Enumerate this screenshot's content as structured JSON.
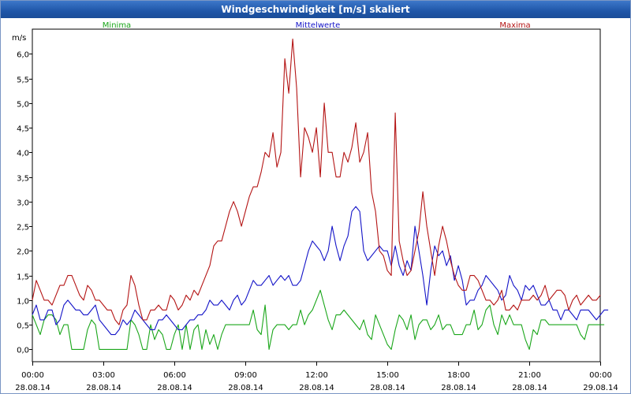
{
  "window_title": "Windgeschwindigkeit [m/s] skaliert",
  "chart_data": {
    "type": "line",
    "title": "Windgeschwindigkeit [m/s] skaliert",
    "ylabel": "m/s",
    "xlabel": "",
    "ylim": [
      -0.25,
      6.5
    ],
    "yticks": [
      0.0,
      0.5,
      1.0,
      1.5,
      2.0,
      2.5,
      3.0,
      3.5,
      4.0,
      4.5,
      5.0,
      5.5,
      6.0
    ],
    "ytick_labels": [
      "0,0",
      "0,5",
      "1,0",
      "1,5",
      "2,0",
      "2,5",
      "3,0",
      "3,5",
      "4,0",
      "4,5",
      "5,0",
      "5,5",
      "6,0"
    ],
    "xlim": [
      0,
      24
    ],
    "xticks": [
      0,
      3,
      6,
      9,
      12,
      15,
      18,
      21,
      24
    ],
    "xtick_labels": [
      [
        "00:00",
        "28.08.14"
      ],
      [
        "03:00",
        "28.08.14"
      ],
      [
        "06:00",
        "28.08.14"
      ],
      [
        "09:00",
        "28.08.14"
      ],
      [
        "12:00",
        "28.08.14"
      ],
      [
        "15:00",
        "28.08.14"
      ],
      [
        "18:00",
        "28.08.14"
      ],
      [
        "21:00",
        "28.08.14"
      ],
      [
        "00:00",
        "29.08.14"
      ]
    ],
    "grid": true,
    "legend_position": "top",
    "x_step_hours": 0.1667,
    "series": [
      {
        "name": "Minima",
        "color": "#1aa61a",
        "values": [
          0.7,
          0.5,
          0.3,
          0.6,
          0.7,
          0.7,
          0.6,
          0.3,
          0.5,
          0.5,
          0.0,
          0.0,
          0.0,
          0.0,
          0.4,
          0.6,
          0.5,
          0.0,
          0.0,
          0.0,
          0.0,
          0.0,
          0.0,
          0.0,
          0.0,
          0.6,
          0.5,
          0.3,
          0.0,
          0.0,
          0.5,
          0.2,
          0.4,
          0.3,
          0.0,
          0.0,
          0.3,
          0.5,
          0.0,
          0.5,
          0.0,
          0.4,
          0.5,
          0.0,
          0.4,
          0.1,
          0.3,
          0.0,
          0.3,
          0.5,
          0.5,
          0.5,
          0.5,
          0.5,
          0.5,
          0.5,
          0.8,
          0.4,
          0.3,
          0.9,
          0.0,
          0.4,
          0.5,
          0.5,
          0.5,
          0.4,
          0.5,
          0.5,
          0.8,
          0.5,
          0.7,
          0.8,
          1.0,
          1.2,
          0.9,
          0.6,
          0.4,
          0.7,
          0.7,
          0.8,
          0.7,
          0.6,
          0.5,
          0.4,
          0.6,
          0.3,
          0.2,
          0.7,
          0.5,
          0.3,
          0.1,
          0.0,
          0.4,
          0.7,
          0.6,
          0.4,
          0.7,
          0.2,
          0.5,
          0.6,
          0.6,
          0.4,
          0.5,
          0.7,
          0.4,
          0.5,
          0.5,
          0.3,
          0.3,
          0.3,
          0.5,
          0.5,
          0.8,
          0.4,
          0.5,
          0.8,
          0.9,
          0.5,
          0.3,
          0.7,
          0.5,
          0.7,
          0.5,
          0.5,
          0.5,
          0.2,
          0.0,
          0.4,
          0.3,
          0.6,
          0.6,
          0.5,
          0.5,
          0.5,
          0.5,
          0.5,
          0.5,
          0.5,
          0.5,
          0.3,
          0.2,
          0.5,
          0.5,
          0.5,
          0.5,
          0.5
        ]
      },
      {
        "name": "Mittelwerte",
        "color": "#1414c8",
        "values": [
          0.7,
          0.9,
          0.6,
          0.6,
          0.8,
          0.8,
          0.5,
          0.6,
          0.9,
          1.0,
          0.9,
          0.8,
          0.8,
          0.7,
          0.7,
          0.8,
          0.9,
          0.6,
          0.5,
          0.4,
          0.3,
          0.3,
          0.4,
          0.6,
          0.5,
          0.6,
          0.8,
          0.7,
          0.6,
          0.5,
          0.4,
          0.4,
          0.6,
          0.6,
          0.7,
          0.6,
          0.5,
          0.4,
          0.4,
          0.5,
          0.6,
          0.6,
          0.7,
          0.7,
          0.8,
          1.0,
          0.9,
          0.9,
          1.0,
          0.9,
          0.8,
          1.0,
          1.1,
          0.9,
          1.0,
          1.2,
          1.4,
          1.3,
          1.3,
          1.4,
          1.5,
          1.3,
          1.4,
          1.5,
          1.4,
          1.5,
          1.3,
          1.3,
          1.4,
          1.7,
          2.0,
          2.2,
          2.1,
          2.0,
          1.8,
          2.0,
          2.5,
          2.1,
          1.8,
          2.1,
          2.3,
          2.8,
          2.9,
          2.8,
          2.0,
          1.8,
          1.9,
          2.0,
          2.1,
          2.0,
          2.0,
          1.7,
          2.1,
          1.7,
          1.5,
          1.8,
          1.6,
          2.5,
          2.0,
          1.5,
          0.9,
          1.6,
          2.1,
          1.9,
          2.0,
          1.7,
          1.9,
          1.4,
          1.7,
          1.4,
          0.9,
          1.0,
          1.0,
          1.2,
          1.3,
          1.5,
          1.4,
          1.3,
          1.2,
          1.0,
          1.1,
          1.5,
          1.3,
          1.2,
          1.0,
          1.3,
          1.2,
          1.3,
          1.1,
          0.9,
          0.9,
          1.0,
          0.8,
          0.8,
          0.6,
          0.8,
          0.8,
          0.7,
          0.6,
          0.8,
          0.8,
          0.8,
          0.7,
          0.6,
          0.7,
          0.8,
          0.8
        ]
      },
      {
        "name": "Maxima",
        "color": "#b41414",
        "values": [
          1.0,
          1.4,
          1.2,
          1.0,
          1.0,
          0.9,
          1.1,
          1.3,
          1.3,
          1.5,
          1.5,
          1.3,
          1.1,
          1.0,
          1.3,
          1.2,
          1.0,
          1.0,
          0.9,
          0.8,
          0.8,
          0.6,
          0.5,
          0.8,
          0.9,
          1.5,
          1.3,
          0.9,
          0.6,
          0.6,
          0.8,
          0.8,
          0.9,
          0.8,
          0.8,
          1.1,
          1.0,
          0.8,
          0.9,
          1.1,
          1.0,
          1.2,
          1.1,
          1.3,
          1.5,
          1.7,
          2.1,
          2.2,
          2.2,
          2.5,
          2.8,
          3.0,
          2.8,
          2.5,
          2.8,
          3.1,
          3.3,
          3.3,
          3.6,
          4.0,
          3.9,
          4.4,
          3.7,
          4.0,
          5.9,
          5.2,
          6.3,
          5.3,
          3.5,
          4.5,
          4.3,
          4.0,
          4.5,
          3.5,
          5.0,
          4.0,
          4.0,
          3.5,
          3.5,
          4.0,
          3.8,
          4.1,
          4.6,
          3.8,
          4.0,
          4.4,
          3.2,
          2.8,
          2.0,
          1.9,
          1.6,
          1.5,
          4.8,
          2.2,
          1.8,
          1.5,
          1.6,
          2.0,
          2.4,
          3.2,
          2.5,
          2.0,
          1.5,
          2.1,
          2.5,
          2.2,
          1.8,
          1.5,
          1.3,
          1.2,
          1.2,
          1.5,
          1.5,
          1.4,
          1.2,
          1.0,
          1.0,
          0.9,
          1.0,
          1.2,
          0.8,
          0.8,
          0.9,
          0.8,
          1.0,
          1.0,
          1.0,
          1.1,
          1.0,
          1.1,
          1.3,
          1.0,
          1.1,
          1.2,
          1.2,
          1.1,
          0.8,
          1.0,
          1.1,
          0.9,
          1.0,
          1.1,
          1.0,
          1.0,
          1.1
        ]
      }
    ]
  }
}
